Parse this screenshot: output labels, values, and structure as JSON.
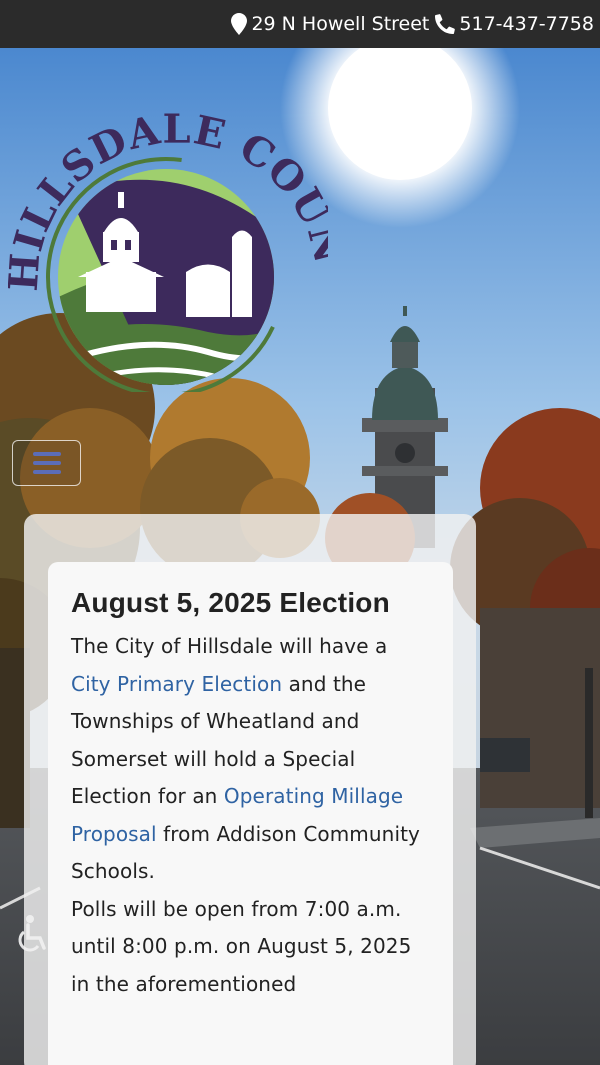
{
  "topbar": {
    "address_icon": "map-marker-icon",
    "address": "29 N  Howell Street",
    "phone_icon": "phone-icon",
    "phone": "517-437-7758"
  },
  "logo": {
    "text": "HILLSDALE COUNTY",
    "colors": {
      "purple": "#3d2a5c",
      "green": "#4e7a3a",
      "light_green": "#9fcf6e"
    }
  },
  "nav": {
    "menu_icon": "hamburger-menu-icon"
  },
  "accessibility": {
    "icon": "wheelchair-accessibility-icon"
  },
  "article": {
    "title": "August 5, 2025 Election",
    "p1_text1": "The City of Hillsdale will have a ",
    "p1_link1": "City Primary Election",
    "p1_text2": " and the Townships of Wheatland and Somerset will hold a Special Election for an ",
    "p1_link2": "Operating Millage Proposal",
    "p1_text3": " from Addison Community Schools.",
    "p2": "Polls will be open from 7:00 a.m. until 8:00 p.m. on August 5, 2025 in the aforementioned",
    "link_color": "#2f63a3"
  }
}
